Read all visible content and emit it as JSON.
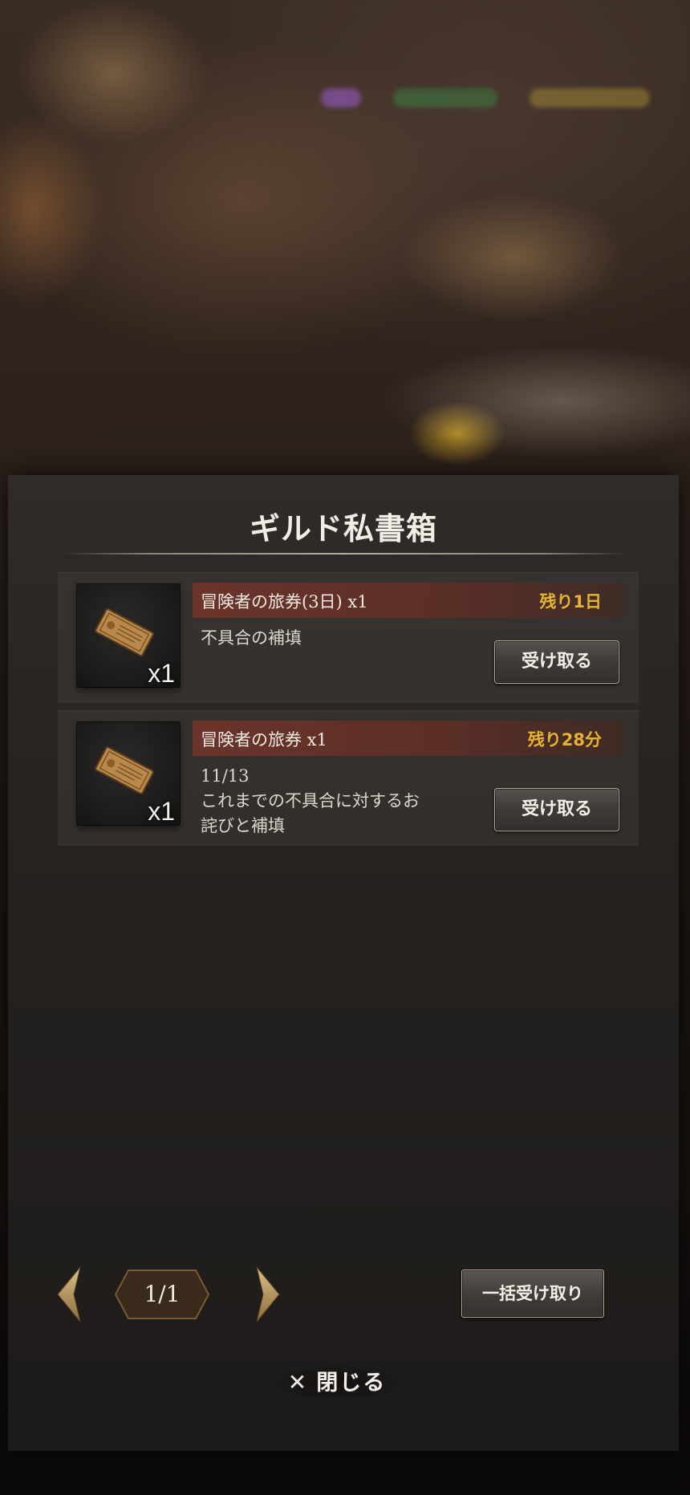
{
  "colors": {
    "accent_gold": "#e6b32f",
    "name_bar": "#6e342a",
    "panel_bg": "#302c2a",
    "button_border": "#b4a68a"
  },
  "dialog": {
    "title": "ギルド私書箱"
  },
  "mail_items": [
    {
      "icon": "ticket-icon",
      "quantity_badge": "x1",
      "name": "冒険者の旅券(3日) x1",
      "remaining": "残り1日",
      "description": "不具合の補填",
      "receive_label": "受け取る"
    },
    {
      "icon": "ticket-icon",
      "quantity_badge": "x1",
      "name": "冒険者の旅券  x1",
      "remaining": "残り28分",
      "description": "11/13\nこれまでの不具合に対するお\n詫びと補填",
      "receive_label": "受け取る"
    }
  ],
  "pagination": {
    "page": "1/1",
    "prev_icon": "chevron-left-icon",
    "next_icon": "chevron-right-icon"
  },
  "bulk_receive_label": "一括受け取り",
  "close": {
    "icon": "close-icon",
    "label": "閉じる"
  }
}
